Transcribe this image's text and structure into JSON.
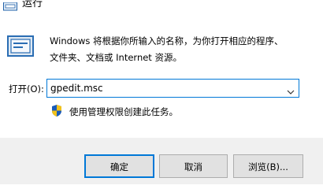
{
  "window": {
    "title": "运行",
    "icon": "run-window-icon"
  },
  "dialog": {
    "icon": "run-program-icon",
    "description_line1": "Windows 将根据你所输入的名称，为你打开相应的程序、",
    "description_line2": "文件夹、文档或 Internet 资源。",
    "open_label": "打开(O):",
    "open_value": "gpedit.msc",
    "admin_icon": "uac-shield-icon",
    "admin_text": "使用管理权限创建此任务。"
  },
  "buttons": {
    "ok_label": "确定",
    "cancel_label": "取消",
    "browse_label": "浏览(B)..."
  },
  "colors": {
    "accent": "#0078d7",
    "footer_bg": "#f0f0f0",
    "button_bg": "#e1e1e1"
  }
}
